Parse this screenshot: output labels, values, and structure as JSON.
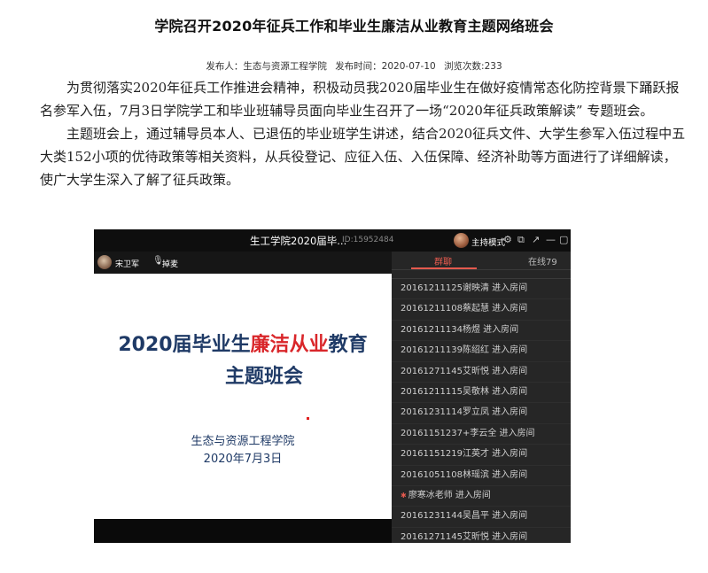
{
  "article": {
    "title": "学院召开2020年征兵工作和毕业生廉洁从业教育主题网络班会",
    "meta": {
      "publisher": "发布人：生态与资源工程学院",
      "publish_time": "发布时间：2020-07-10",
      "views": "浏览次数:233"
    },
    "paragraphs": [
      "为贯彻落实2020年征兵工作推进会精神，积极动员我2020届毕业生在做好疫情常态化防控背景下踊跃报名参军入伍，7月3日学院学工和毕业班辅导员面向毕业生召开了一场“2020年征兵政策解读” 专题班会。",
      "主题班会上，通过辅导员本人、已退伍的毕业班学生讲述，结合2020征兵文件、大学生参军入伍过程中五大类152小项的优待政策等相关资料，从兵役登记、应征入伍、入伍保障、经济补助等方面进行了详细解读，使广大学生深入了解了征兵政策。"
    ]
  },
  "stream": {
    "window_title": "生工学院2020届毕...",
    "room_id": "ID:15952484",
    "host_mode": "主持模式",
    "speaker_name": "宋卫军",
    "speaking": "掉麦",
    "tabs": {
      "chat": "群聊",
      "online": "在线79"
    },
    "slide": {
      "title_part1": "2020届毕业生",
      "title_highlight": "廉洁从业",
      "title_part2": "教育",
      "title_line2": "主题班会",
      "organization": "生态与资源工程学院",
      "date": "2020年7月3日"
    },
    "chat_messages": [
      "20161211125谢映清 进入房间",
      "20161211108蔡起慧 进入房间",
      "20161211134杨煜 进入房间",
      "20161211139陈绍红 进入房间",
      "20161271145艾昕悦 进入房间",
      "20161211115吴敬林 进入房间",
      "20161231114罗立凤 进入房间",
      "20161151237+李云全 进入房间",
      "20161151219江英才 进入房间",
      "20161051108林瑶滨 进入房间",
      "廖寒冰老师 进入房间",
      "20161231144吴昌平 进入房间",
      "20161271145艾昕悦 进入房间"
    ],
    "icons": [
      "settings-icon",
      "popout-icon",
      "minimize-icon",
      "maximize-icon",
      "mic-icon"
    ]
  }
}
